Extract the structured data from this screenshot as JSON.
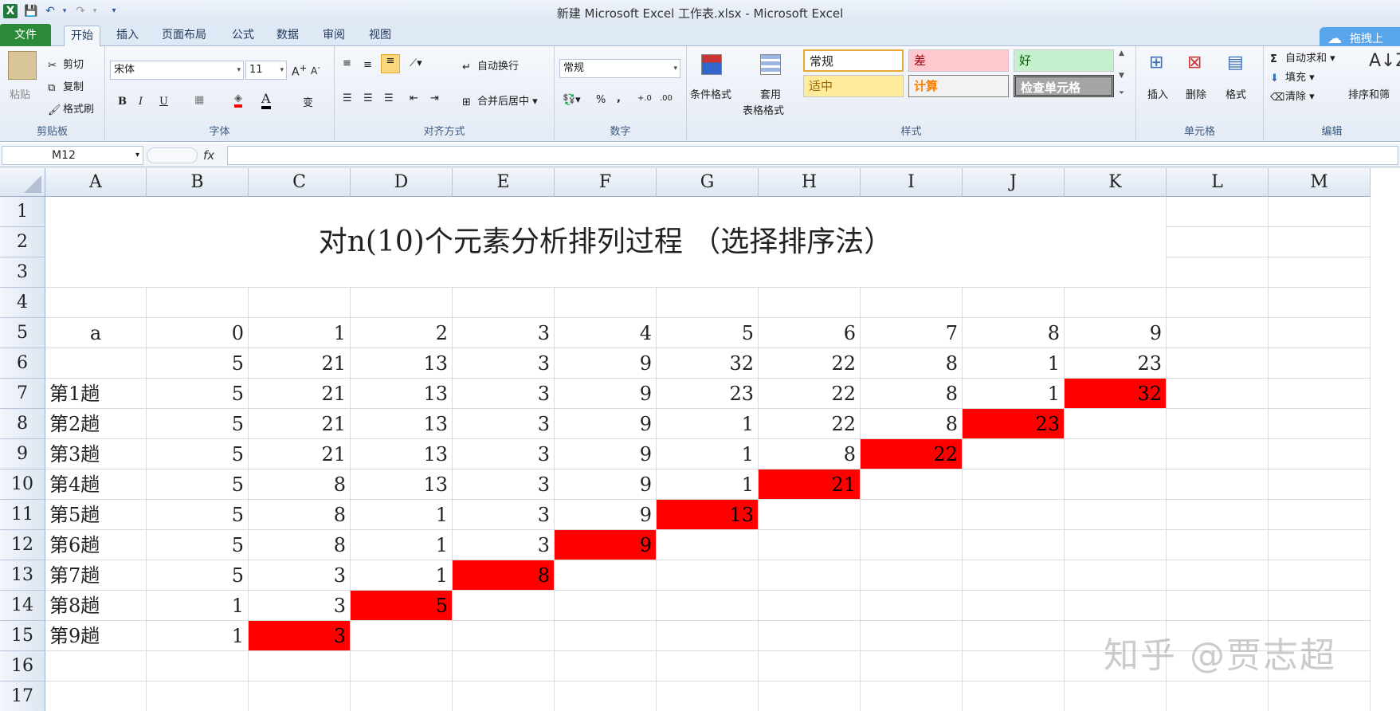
{
  "window": {
    "title": "新建 Microsoft Excel 工作表.xlsx - Microsoft Excel"
  },
  "quick_access": {
    "icons": [
      "excel-logo-icon",
      "save-icon",
      "undo-icon",
      "redo-icon",
      "customize-icon"
    ]
  },
  "tabs": {
    "file": "文件",
    "home": "开始",
    "insert": "插入",
    "layout": "页面布局",
    "formula": "公式",
    "data": "数据",
    "review": "审阅",
    "view": "视图"
  },
  "cloud_button": "拖拽上",
  "ribbon": {
    "clipboard": {
      "label": "剪贴板",
      "paste": "粘贴",
      "cut": "剪切",
      "copy": "复制",
      "format_painter": "格式刷"
    },
    "font": {
      "label": "字体",
      "font_name": "宋体",
      "font_size": "11",
      "bold": "B",
      "italic": "I",
      "underline": "U",
      "font_color": "A"
    },
    "alignment": {
      "label": "对齐方式",
      "wrap": "自动换行",
      "merge": "合并后居中"
    },
    "number": {
      "label": "数字",
      "format": "常规",
      "percent": "%",
      "comma": ","
    },
    "styles": {
      "label": "样式",
      "conditional": "条件格式",
      "table_format_1": "套用",
      "table_format_2": "表格格式",
      "normal": "常规",
      "bad": "差",
      "good": "好",
      "neutral": "适中",
      "calc": "计算",
      "check": "检查单元格"
    },
    "cells": {
      "label": "单元格",
      "insert": "插入",
      "delete": "删除",
      "format": "格式"
    },
    "editing": {
      "label": "编辑",
      "autosum": "自动求和",
      "fill": "填充",
      "clear": "清除",
      "sort": "排序和筛"
    }
  },
  "formula_bar": {
    "name_box": "M12",
    "fx": "fx",
    "formula": ""
  },
  "sheet": {
    "columns": [
      "A",
      "B",
      "C",
      "D",
      "E",
      "F",
      "G",
      "H",
      "I",
      "J",
      "K",
      "L",
      "M"
    ],
    "rows": [
      "1",
      "2",
      "3",
      "4",
      "5",
      "6",
      "7",
      "8",
      "9",
      "10",
      "11",
      "12",
      "13",
      "14",
      "15",
      "16",
      "17"
    ],
    "title": "对n(10)个元素分析排列过程 （选择排序法）",
    "row5_label": "a",
    "row5": [
      "0",
      "1",
      "2",
      "3",
      "4",
      "5",
      "6",
      "7",
      "8",
      "9"
    ],
    "row6": [
      "5",
      "21",
      "13",
      "3",
      "9",
      "32",
      "22",
      "8",
      "1",
      "23"
    ],
    "passes": [
      {
        "label": "第1趟",
        "values": [
          "5",
          "21",
          "13",
          "3",
          "9",
          "23",
          "22",
          "8",
          "1",
          "32"
        ]
      },
      {
        "label": "第2趟",
        "values": [
          "5",
          "21",
          "13",
          "3",
          "9",
          "1",
          "22",
          "8",
          "23"
        ]
      },
      {
        "label": "第3趟",
        "values": [
          "5",
          "21",
          "13",
          "3",
          "9",
          "1",
          "8",
          "22"
        ]
      },
      {
        "label": "第4趟",
        "values": [
          "5",
          "8",
          "13",
          "3",
          "9",
          "1",
          "21"
        ]
      },
      {
        "label": "第5趟",
        "values": [
          "5",
          "8",
          "1",
          "3",
          "9",
          "13"
        ]
      },
      {
        "label": "第6趟",
        "values": [
          "5",
          "8",
          "1",
          "3",
          "9"
        ]
      },
      {
        "label": "第7趟",
        "values": [
          "5",
          "3",
          "1",
          "8"
        ]
      },
      {
        "label": "第8趟",
        "values": [
          "1",
          "3",
          "5"
        ]
      },
      {
        "label": "第9趟",
        "values": [
          "1",
          "3"
        ]
      }
    ],
    "highlight_color": "#ff0000"
  },
  "watermark": "知乎 @贾志超"
}
